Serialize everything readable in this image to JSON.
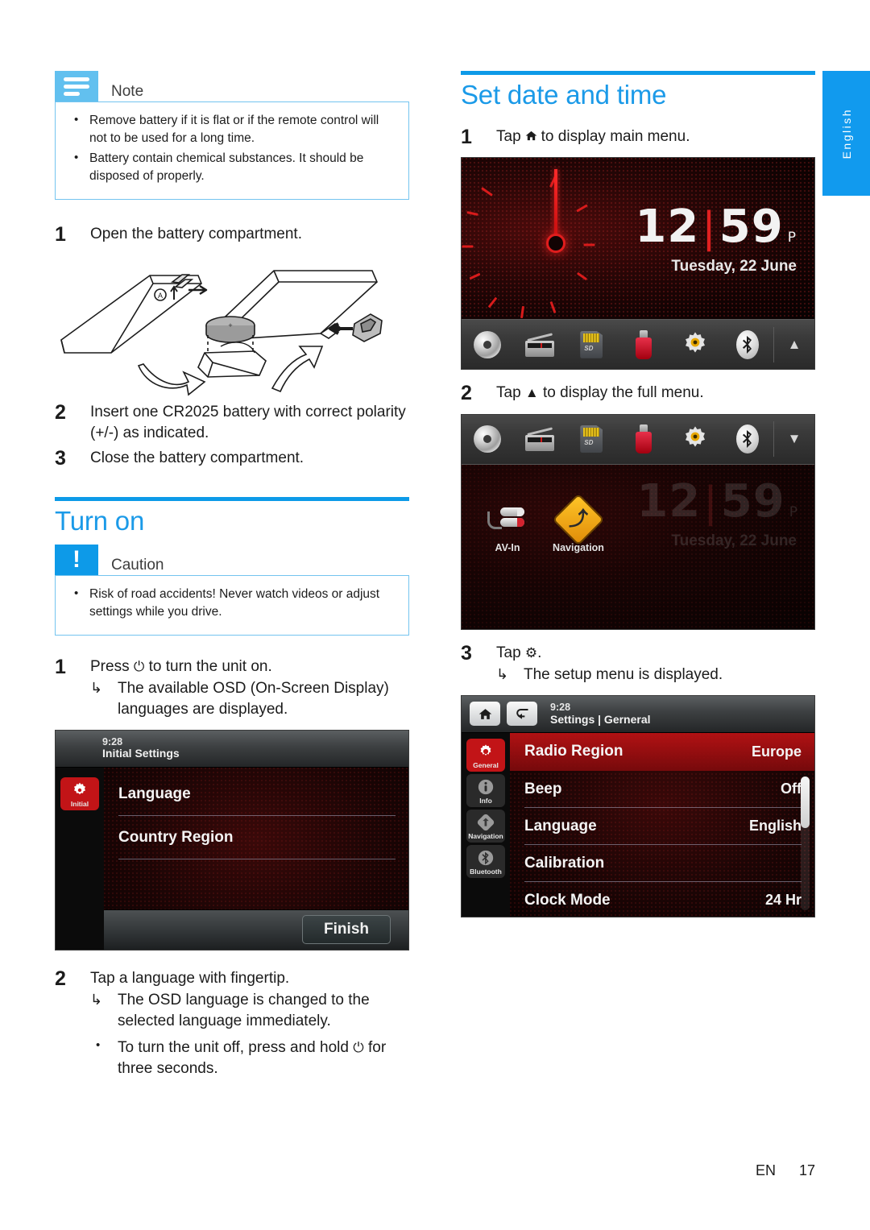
{
  "page": {
    "language_tab": "English",
    "footer_lang": "EN",
    "footer_page": "17"
  },
  "left_column": {
    "note": {
      "title": "Note",
      "icon": "note-lines-icon",
      "items": [
        "Remove battery if it is flat or if the remote control will not to be used for a long time.",
        "Battery contain chemical substances. It should be disposed of properly."
      ]
    },
    "battery_steps": [
      {
        "num": "1",
        "text": "Open the battery compartment."
      },
      {
        "num": "2",
        "text": "Insert one CR2025 battery with correct polarity (+/-) as indicated."
      },
      {
        "num": "3",
        "text": "Close the battery compartment."
      }
    ],
    "figure_labels": {
      "cover_marker": "A"
    },
    "turn_on": {
      "heading": "Turn on",
      "caution": {
        "title": "Caution",
        "icon": "exclamation-icon",
        "items": [
          "Risk of road accidents! Never watch videos or adjust settings while you drive."
        ]
      },
      "step1": {
        "num": "1",
        "text_before": "Press",
        "icon": "power-icon",
        "icon_glyph": "⏻",
        "text_after": "to turn the unit on.",
        "sub_mark": "↳",
        "sub_text": "The available OSD (On-Screen Display) languages are displayed."
      },
      "step2": {
        "num": "2",
        "text": "Tap a language with fingertip.",
        "sub_mark": "↳",
        "sub_text": "The OSD language is changed to the selected language immediately.",
        "bullet_mark": "•",
        "bullet_before": "To turn the unit off, press and hold",
        "bullet_icon": "power-icon",
        "bullet_icon_glyph": "⏻",
        "bullet_after": "for three seconds."
      }
    },
    "initial_settings_screen": {
      "time": "9:28",
      "title": "Initial Settings",
      "side_tab": {
        "label": "Initial",
        "icon": "gear-icon"
      },
      "rows": [
        "Language",
        "Country Region"
      ],
      "finish_button": "Finish"
    }
  },
  "right_column": {
    "heading": "Set date and time",
    "step1": {
      "num": "1",
      "text_before": "Tap",
      "icon": "home-icon",
      "icon_glyph": "⌂",
      "text_after": "to display main menu."
    },
    "clock_screen": {
      "hours": "12",
      "separator": "|",
      "minutes": "59",
      "meridiem": "P",
      "date": "Tuesday, 22 June",
      "toolbar_icons": [
        "disc-icon",
        "radio-icon",
        "sd-card-icon",
        "usb-icon",
        "gear-icon",
        "bluetooth-icon"
      ],
      "expand_arrow": "▲"
    },
    "step2": {
      "num": "2",
      "text_before": "Tap",
      "icon": "triangle-up-icon",
      "icon_glyph": "▲",
      "text_after": "to display the full menu."
    },
    "menu_screen": {
      "toolbar_icons": [
        "disc-icon",
        "radio-icon",
        "sd-card-icon",
        "usb-icon",
        "gear-icon",
        "bluetooth-icon"
      ],
      "collapse_arrow": "▼",
      "apps": [
        {
          "label": "AV-In",
          "icon": "av-in-icon"
        },
        {
          "label": "Navigation",
          "icon": "navigation-icon"
        }
      ],
      "ghost_hours": "12",
      "ghost_separator": "|",
      "ghost_minutes": "59",
      "ghost_meridiem": "P",
      "ghost_date": "Tuesday, 22 June"
    },
    "step3": {
      "num": "3",
      "text_before": "Tap",
      "icon": "gear-icon",
      "icon_glyph": "⚙",
      "text_after": ".",
      "sub_mark": "↳",
      "sub_text": "The setup menu is displayed."
    },
    "settings_screen": {
      "home_button": "home-icon",
      "back_button": "back-arrow-icon",
      "time": "9:28",
      "breadcrumb": "Settings | Gerneral",
      "sidebar": [
        {
          "label": "General",
          "icon": "gear-icon",
          "active": true
        },
        {
          "label": "Info",
          "icon": "info-icon",
          "active": false
        },
        {
          "label": "Navigation",
          "icon": "navigation-icon",
          "active": false
        },
        {
          "label": "Bluetooth",
          "icon": "bluetooth-icon",
          "active": false
        }
      ],
      "rows": [
        {
          "key": "Radio Region",
          "value": "Europe",
          "selected": true
        },
        {
          "key": "Beep",
          "value": "Off",
          "selected": false
        },
        {
          "key": "Language",
          "value": "English",
          "selected": false
        },
        {
          "key": "Calibration",
          "value": "",
          "selected": false
        },
        {
          "key": "Clock Mode",
          "value": "24 Hr",
          "selected": false
        }
      ]
    }
  },
  "colors": {
    "brand_blue": "#0d9ae8",
    "note_blue": "#62c0ef",
    "device_red": "#c21417",
    "nav_amber": "#f0a91a"
  }
}
